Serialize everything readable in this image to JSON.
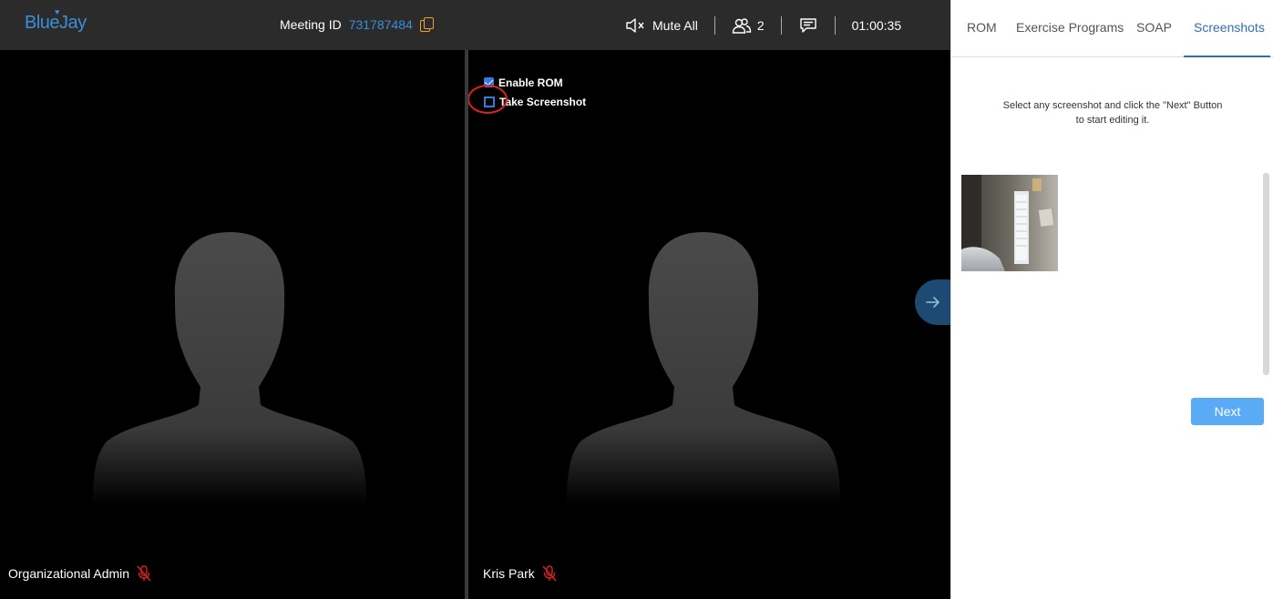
{
  "header": {
    "logo": "BlueJay",
    "meeting_id_label": "Meeting ID",
    "meeting_id": "731787484",
    "mute_all_label": "Mute All",
    "participant_count": "2",
    "timer": "01:00:35"
  },
  "video": {
    "left_participant": "Organizational Admin",
    "right_participant": "Kris Park",
    "enable_rom_label": "Enable ROM",
    "enable_rom_checked": true,
    "take_screenshot_label": "Take Screenshot"
  },
  "panel": {
    "tabs": [
      {
        "label": "ROM",
        "active": false
      },
      {
        "label": "Exercise Programs",
        "active": false
      },
      {
        "label": "SOAP",
        "active": false
      },
      {
        "label": "Screenshots",
        "active": true
      }
    ],
    "instructions_line1": "Select any screenshot and click the \"Next\" Button",
    "instructions_line2": "to start editing it.",
    "next_label": "Next"
  },
  "colors": {
    "accent": "#3b8ed8",
    "copy_icon": "#f0a030",
    "mic_off": "#e02020",
    "next_button": "#5aabf5"
  }
}
